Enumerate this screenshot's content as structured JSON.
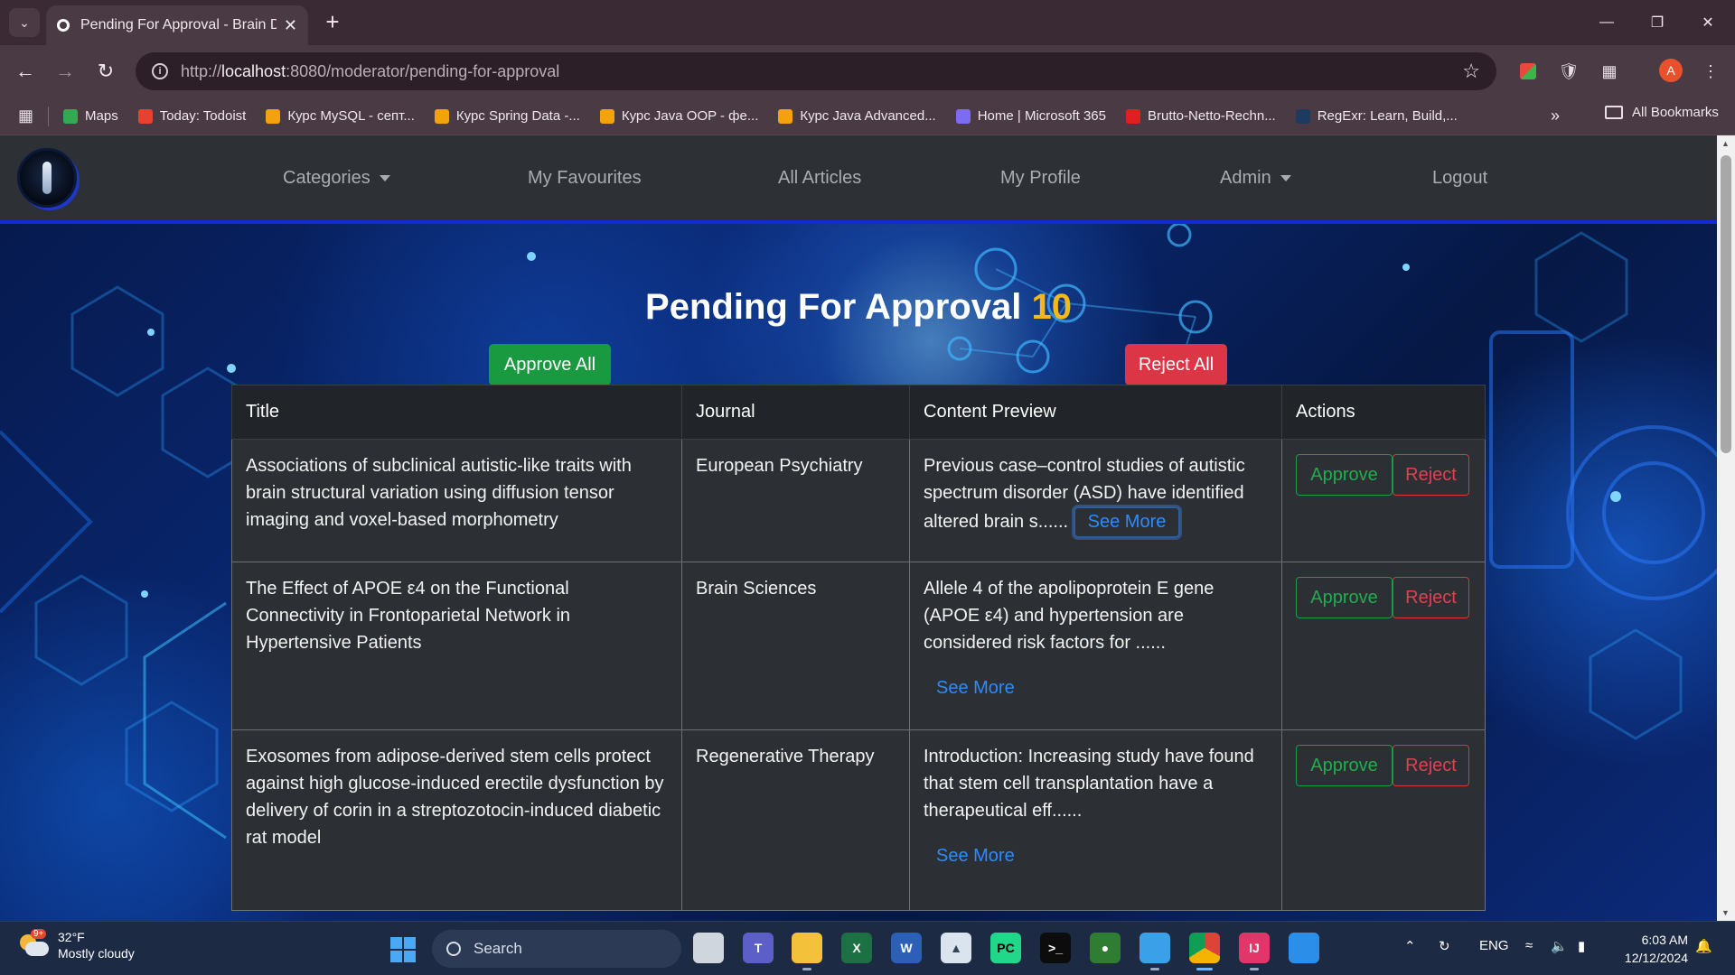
{
  "browser": {
    "tab_title": "Pending For Approval - Brain Di",
    "url_host": "localhost",
    "url_rest": ":8080/moderator/pending-for-approval",
    "url_prefix": "http://",
    "bookmarks": [
      {
        "label": "Maps",
        "color": "#34a853"
      },
      {
        "label": "Today: Todoist",
        "color": "#e44332"
      },
      {
        "label": "Курс MySQL - септ...",
        "color": "#f2a20c"
      },
      {
        "label": "Курс Spring Data -...",
        "color": "#f2a20c"
      },
      {
        "label": "Курс Java OOP - фе...",
        "color": "#f2a20c"
      },
      {
        "label": "Курс Java Advanced...",
        "color": "#f2a20c"
      },
      {
        "label": "Home | Microsoft 365",
        "color": "#7b6cf0"
      },
      {
        "label": "Brutto-Netto-Rechn...",
        "color": "#e02020"
      },
      {
        "label": "RegExr: Learn, Build,...",
        "color": "#1e3a5f"
      }
    ],
    "all_bookmarks": "All Bookmarks",
    "profile_initial": "A"
  },
  "nav": {
    "categories": "Categories",
    "favourites": "My Favourites",
    "articles": "All Articles",
    "profile": "My Profile",
    "admin": "Admin",
    "logout": "Logout"
  },
  "page": {
    "title": "Pending For Approval",
    "count": "10",
    "approve_all": "Approve All",
    "reject_all": "Reject All"
  },
  "table": {
    "headers": [
      "Title",
      "Journal",
      "Content Preview",
      "Actions"
    ],
    "rows": [
      {
        "title": "Associations of subclinical autistic-like traits with brain structural variation using diffusion tensor imaging and voxel-based morphometry",
        "journal": "European Psychiatry",
        "preview": "Previous case–control studies of autistic spectrum disorder (ASD) have identified altered brain s......",
        "see_more": "See More",
        "approve": "Approve",
        "reject": "Reject"
      },
      {
        "title": "The Effect of APOE ε4 on the Functional Connectivity in Frontoparietal Network in Hypertensive Patients",
        "journal": "Brain Sciences",
        "preview": "Allele 4 of the apolipoprotein E gene (APOE ε4) and hypertension are considered risk factors for ......",
        "see_more": "See More",
        "approve": "Approve",
        "reject": "Reject"
      },
      {
        "title": "Exosomes from adipose-derived stem cells protect against high glucose-induced erectile dysfunction by delivery of corin in a streptozotocin-induced diabetic rat model",
        "journal": "Regenerative Therapy",
        "preview": "Introduction: Increasing study have found that stem cell transplantation have a therapeutical eff......",
        "see_more": "See More",
        "approve": "Approve",
        "reject": "Reject"
      }
    ]
  },
  "taskbar": {
    "weather_temp": "32°F",
    "weather_desc": "Mostly cloudy",
    "weather_badge": "9+",
    "search": "Search",
    "lang": "ENG",
    "time": "6:03 AM",
    "date": "12/12/2024"
  },
  "colors": {
    "approve": "#199a40",
    "reject": "#dc3545",
    "count": "#f5b819",
    "link": "#2b8bff"
  }
}
